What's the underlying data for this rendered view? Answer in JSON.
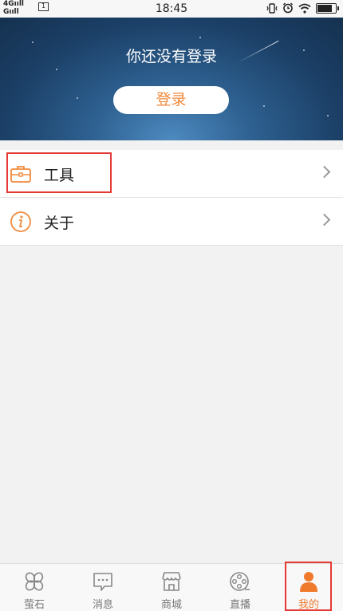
{
  "status_bar": {
    "network_top": "4G",
    "network_bottom": "G",
    "sim_label": "1",
    "time": "18:45",
    "battery_level": 0.85
  },
  "header": {
    "title": "你还没有登录",
    "login_button": "登录"
  },
  "menu": {
    "items": [
      {
        "label": "工具",
        "icon": "toolbox-icon"
      },
      {
        "label": "关于",
        "icon": "info-icon"
      }
    ]
  },
  "tabbar": {
    "tabs": [
      {
        "label": "萤石",
        "icon": "clover-icon",
        "active": false
      },
      {
        "label": "消息",
        "icon": "message-icon",
        "active": false
      },
      {
        "label": "商城",
        "icon": "store-icon",
        "active": false
      },
      {
        "label": "直播",
        "icon": "film-reel-icon",
        "active": false
      },
      {
        "label": "我的",
        "icon": "person-icon",
        "active": true
      }
    ]
  },
  "colors": {
    "accent": "#f07a2c",
    "highlight": "#e53935",
    "header_dark": "#15314f",
    "header_light": "#4d8ac0"
  }
}
